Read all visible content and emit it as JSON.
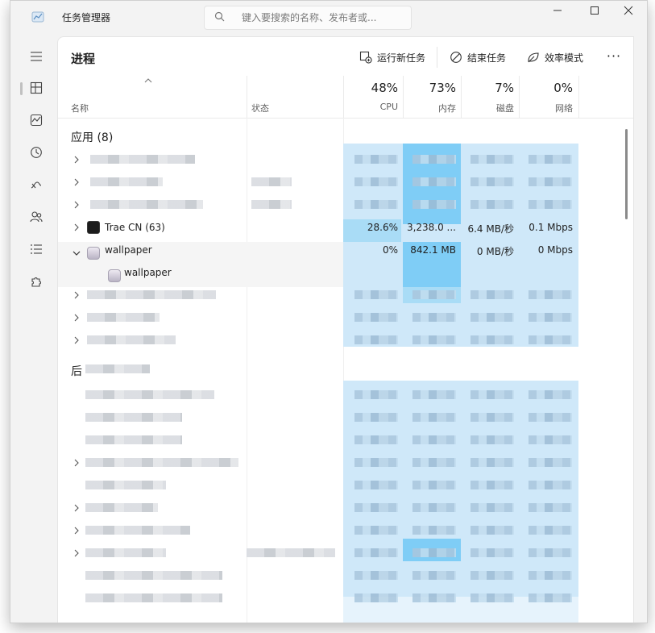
{
  "window": {
    "title": "任务管理器"
  },
  "search": {
    "placeholder": "键入要搜索的名称、发布者或..."
  },
  "nav": {
    "items": [
      "hamburger-menu",
      "processes",
      "performance",
      "app-history",
      "startup-apps",
      "users",
      "details",
      "services"
    ]
  },
  "page": {
    "title": "进程"
  },
  "toolbar": {
    "run_new_task": "运行新任务",
    "end_task": "结束任务",
    "efficiency_mode": "效率模式",
    "more": "···"
  },
  "columns": {
    "name": "名称",
    "status": "状态",
    "cpu": {
      "percent": "48%",
      "label": "CPU"
    },
    "memory": {
      "percent": "73%",
      "label": "内存"
    },
    "disk": {
      "percent": "7%",
      "label": "磁盘"
    },
    "network": {
      "percent": "0%",
      "label": "网络"
    }
  },
  "apps_section": {
    "title": "应用 (8)"
  },
  "background_section": {
    "title": "后"
  },
  "processes": [
    {
      "name": "Trae CN (63)",
      "cpu": "28.6%",
      "memory": "3,238.0 ...",
      "disk": "6.4 MB/秒",
      "network": "0.1 Mbps"
    },
    {
      "name": "wallpaper",
      "cpu": "0%",
      "memory": "842.1 MB",
      "disk": "0 MB/秒",
      "network": "0 Mbps",
      "expanded": true,
      "children": [
        {
          "name": "wallpaper"
        }
      ]
    }
  ],
  "colors": {
    "heat_light": "#cfe8f9",
    "heat_mid": "#a9dcf6",
    "heat_strong": "#7fcdf6",
    "selected_row": "#f5f5f5"
  }
}
